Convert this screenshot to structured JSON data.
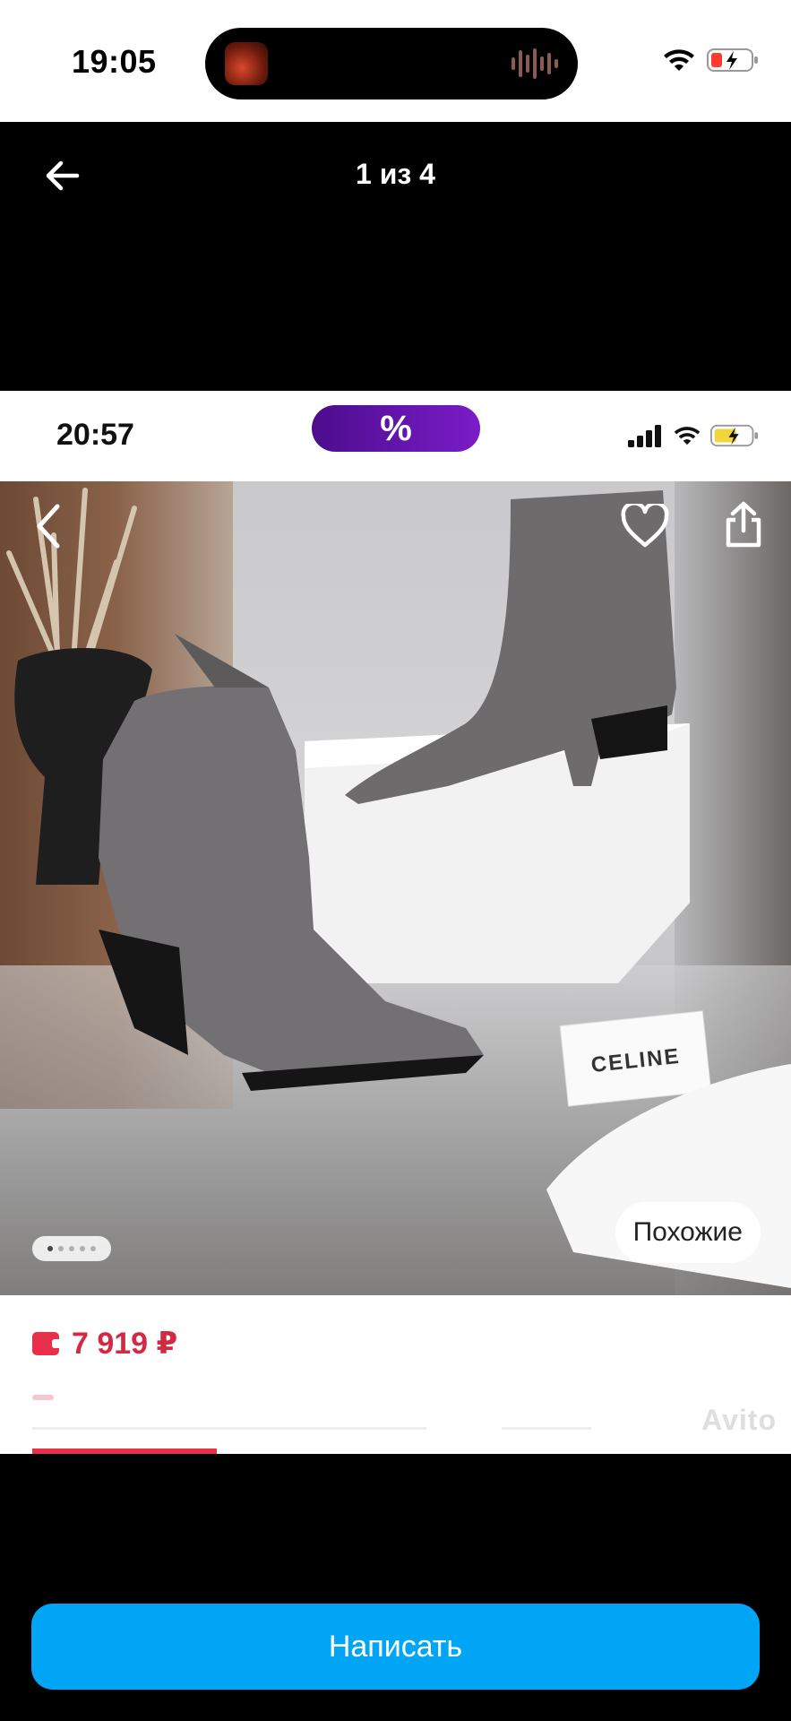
{
  "status_bar": {
    "time": "19:05"
  },
  "viewer": {
    "counter": "1 из 4"
  },
  "screenshot": {
    "status_time": "20:57",
    "promo_label": "%",
    "price": "7 919 ₽",
    "similar_label": "Похожие",
    "box_brand": "CELINE",
    "watermark": "Avito",
    "gallery": {
      "total": 5,
      "active": 1
    }
  },
  "write_button": {
    "label": "Написать"
  },
  "colors": {
    "accent": "#00a6f5",
    "price": "#d12a42",
    "promo": "#5b13a6"
  }
}
